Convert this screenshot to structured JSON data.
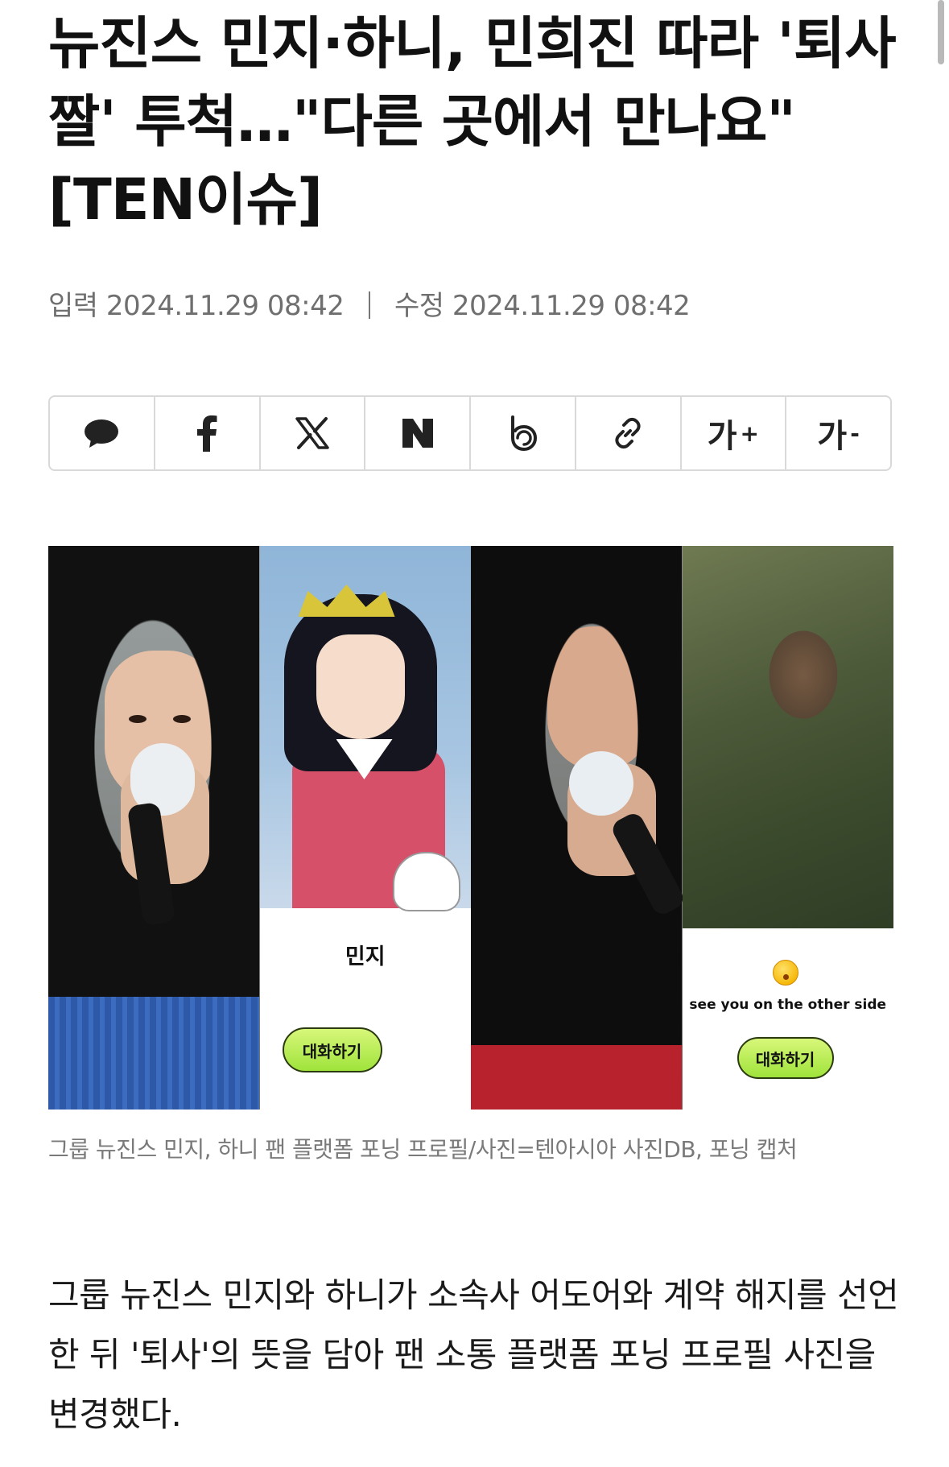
{
  "article": {
    "headline": "뉴진스 민지·하니, 민희진 따라 '퇴사짤' 투척…\"다른 곳에서 만나요\" [TEN이슈]",
    "published_label": "입력",
    "published_time": "2024.11.29 08:42",
    "modified_label": "수정",
    "modified_time": "2024.11.29 08:42",
    "image_caption": "그룹 뉴진스 민지, 하니 팬 플랫폼 포닝 프로필/사진=텐아시아 사진DB, 포닝 캡처",
    "body": "그룹 뉴진스 민지와 하니가 소속사 어도어와 계약 해지를 선언한 뒤 '퇴사'의 뜻을 담아 팬 소통 플랫폼 포닝 프로필 사진을 변경했다."
  },
  "share_bar": {
    "items": [
      {
        "icon": "comment-icon"
      },
      {
        "icon": "facebook-icon"
      },
      {
        "icon": "x-icon"
      },
      {
        "icon": "naver-icon"
      },
      {
        "icon": "band-icon"
      },
      {
        "icon": "link-icon"
      },
      {
        "icon": "font-increase",
        "label": "가",
        "sign": "+"
      },
      {
        "icon": "font-decrease",
        "label": "가",
        "sign": "-"
      }
    ]
  },
  "photo": {
    "profile_minji": {
      "name": "민지",
      "chat_button": "대화하기"
    },
    "profile_hanni": {
      "emoji": "kissing-face-icon",
      "status": "see you on the other side",
      "chat_button": "대화하기"
    }
  },
  "colors": {
    "chat_button_green": "#9fe33b",
    "border_gray": "#d9d9d9"
  }
}
